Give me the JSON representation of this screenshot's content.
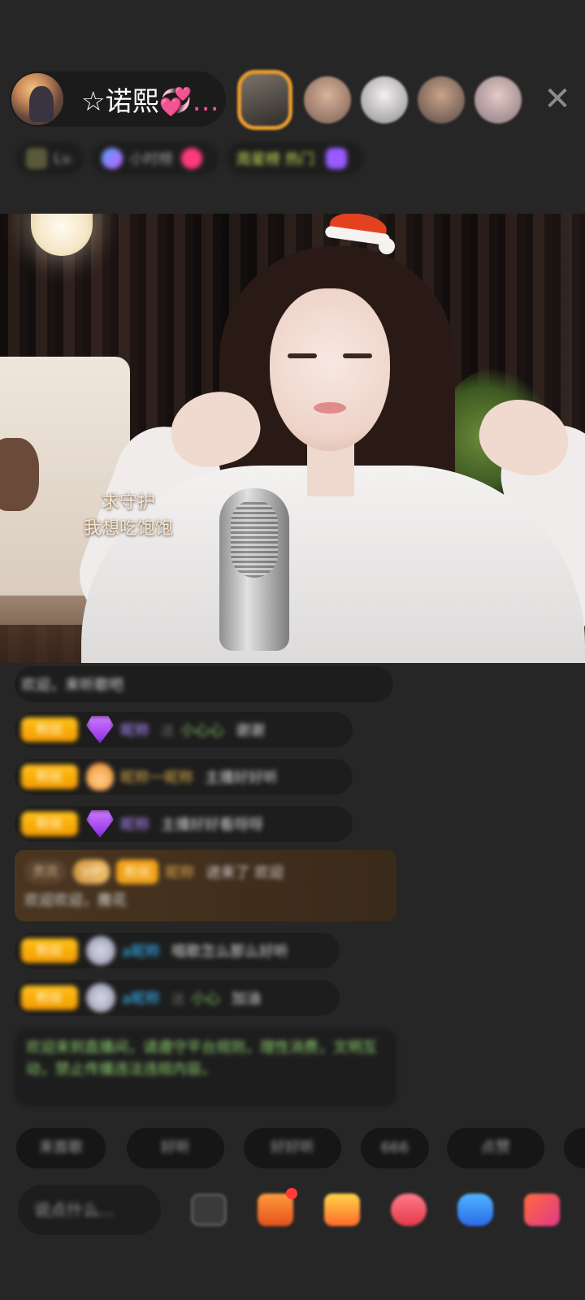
{
  "header": {
    "host_name": "☆诺熙",
    "host_name_suffix": "💞…",
    "viewer_count_blurred": "··",
    "close_icon": "close-icon"
  },
  "info_row": {
    "chip1": "Lv.",
    "chip2": "小时榜",
    "chip3": "周星榜 热门",
    "chip3_color": "#d0e05a"
  },
  "video": {
    "overlay_line1": "求守护",
    "overlay_line2": "我想吃饱饱"
  },
  "chat": {
    "top_line": "欢迎，来听歌吧",
    "messages": [
      {
        "badge": "粉丝",
        "user": "昵称",
        "sep": "送",
        "gift": "小心心",
        "text": "谢谢"
      },
      {
        "badge": "粉丝",
        "user": "昵称一昵称",
        "text": "主播好好听"
      },
      {
        "badge": "粉丝",
        "user": "昵称",
        "text": "主播好好看呀呀"
      },
      {
        "badge": "粉丝",
        "user": "a昵称",
        "text": "唱歌怎么那么好听"
      },
      {
        "badge": "粉丝",
        "user": "a昵称",
        "sep": "送",
        "gift": "小心",
        "text": "加油"
      }
    ],
    "gold_msg": {
      "tag1": "贵宾",
      "tag2": "VIP",
      "tag3": "粉丝",
      "user": "昵称",
      "line1_text": "进来了 欢迎",
      "line2_text": "欢迎欢迎，撒花"
    },
    "system_text": "欢迎来到直播间，请遵守平台规则，理性消费，文明互动，禁止传播违法违规内容。"
  },
  "quick_replies": [
    "来首歌",
    "好听",
    "好好听",
    "666",
    "点赞"
  ],
  "bottom_bar": {
    "input_placeholder": "说点什么...",
    "icons": [
      "emoji-icon",
      "shopping-cart-icon",
      "gift-icon",
      "heart-gift-icon",
      "game-icon",
      "more-icon"
    ]
  }
}
